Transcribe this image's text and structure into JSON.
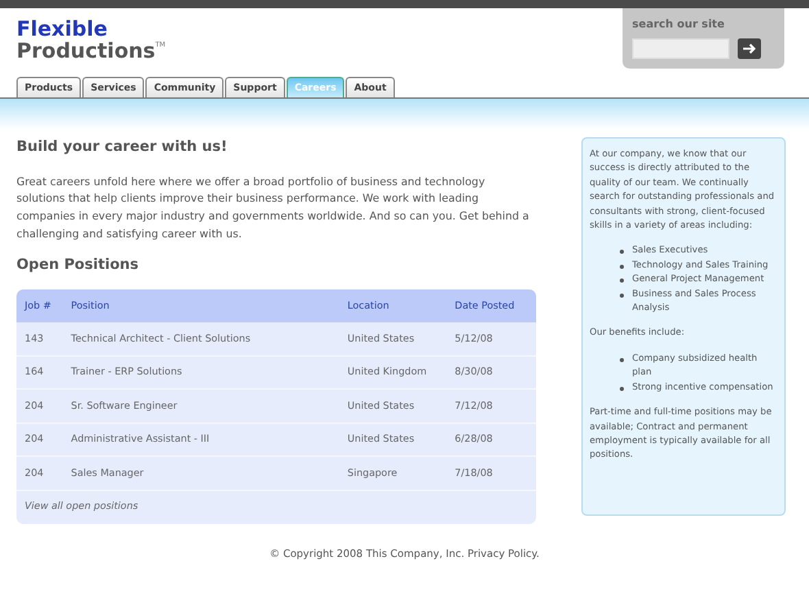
{
  "logo": {
    "line1": "Flexible",
    "line2": "Productions",
    "tm": "TM"
  },
  "search": {
    "label": "search our site"
  },
  "tabs": [
    {
      "label": "Products",
      "selected": false
    },
    {
      "label": "Services",
      "selected": false
    },
    {
      "label": "Community",
      "selected": false
    },
    {
      "label": "Support",
      "selected": false
    },
    {
      "label": "Careers",
      "selected": true
    },
    {
      "label": "About",
      "selected": false
    }
  ],
  "heading": "Build your career with us!",
  "intro": "Great careers unfold here where we offer a broad portfolio of business and technology solutions that help clients improve their business performance. We work with leading companies in every major industry and governments worldwide. And so can you. Get behind a challenging and satisfying career with us.",
  "positions_heading": "Open Positions",
  "table": {
    "columns": [
      "Job #",
      "Position",
      "Location",
      "Date Posted"
    ],
    "rows": [
      [
        "143",
        "Technical Architect - Client Solutions",
        "United States",
        "5/12/08"
      ],
      [
        "164",
        "Trainer - ERP Solutions",
        "United Kingdom",
        "8/30/08"
      ],
      [
        "204",
        "Sr. Software Engineer",
        "United States",
        "7/12/08"
      ],
      [
        "204",
        "Administrative Assistant - III",
        "United States",
        "6/28/08"
      ],
      [
        "204",
        "Sales Manager",
        "Singapore",
        "7/18/08"
      ]
    ],
    "footer_link": "View all open positions"
  },
  "sidebar": {
    "intro": "At our company, we know that our success is directly attributed to the quality of our team. We continually search for outstanding professionals and consultants with strong, client-focused skills in a variety of areas including:",
    "areas": [
      "Sales Executives",
      "Technology and Sales Training",
      "General Project Management",
      "Business and Sales Process Analysis"
    ],
    "benefits_intro": "Our benefits include:",
    "benefits": [
      "Company subsidized health plan",
      "Strong incentive compensation"
    ],
    "closing": "Part-time and full-time positions may be available; Contract and permanent employment is typically available for all positions."
  },
  "footer": "© Copyright 2008 This Company, Inc. Privacy Policy."
}
